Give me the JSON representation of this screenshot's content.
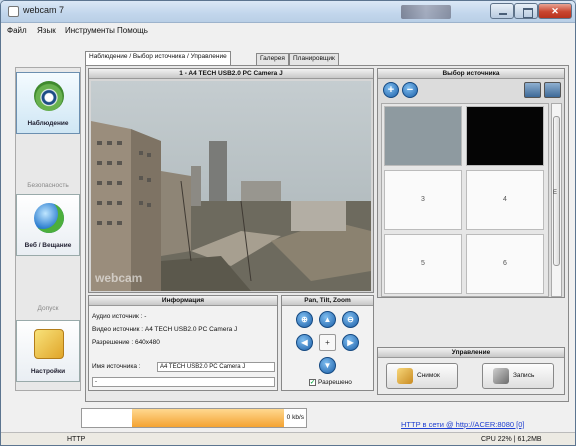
{
  "window": {
    "title": "webcam 7"
  },
  "menu": [
    "Файл",
    "Язык",
    "Инструменты",
    "Помощь"
  ],
  "tabs": [
    "Наблюдение / Выбор источника / Управление",
    "Галерея",
    "Планировщик"
  ],
  "sidebar": {
    "items": [
      {
        "label": "Наблюдение",
        "icon": "eye-icon",
        "active": true
      },
      {
        "label": "Безопасность",
        "icon": "security-icon",
        "active": false
      },
      {
        "label": "Веб / Вещание",
        "icon": "globe-icon",
        "active": false
      },
      {
        "label": "Допуск",
        "icon": "access-icon",
        "active": false
      },
      {
        "label": "Настройки",
        "icon": "settings-icon",
        "active": false
      }
    ]
  },
  "video": {
    "title": "1 - A4 TECH USB2.0 PC Camera J",
    "watermark": "webcam"
  },
  "source": {
    "title": "Выбор источника",
    "cells": [
      "",
      "",
      "3",
      "4",
      "5",
      "6",
      "",
      ""
    ],
    "scroll_marker": "E"
  },
  "info": {
    "title": "Информация",
    "audio": "Аудио источник : -",
    "video_src": "Видео источник : A4 TECH USB2.0 PC Camera J",
    "resolution": "Разрешение : 640x480",
    "name_label": "Имя источника :",
    "name_value": "A4 TECH USB2.0 PC Camera J",
    "extra_value": "-"
  },
  "ptz": {
    "title": "Pan, Tilt, Zoom",
    "center": "+",
    "allowed": "Разрешено"
  },
  "control": {
    "title": "Управление",
    "snapshot": "Снимок",
    "record": "Запись"
  },
  "bandwidth": {
    "value": "0 kb/s"
  },
  "http_link": "HTTP в сети @ http://ACER:8080 [0]",
  "status": {
    "left": "HTTP",
    "right": "CPU 22% | 61,2MB"
  }
}
